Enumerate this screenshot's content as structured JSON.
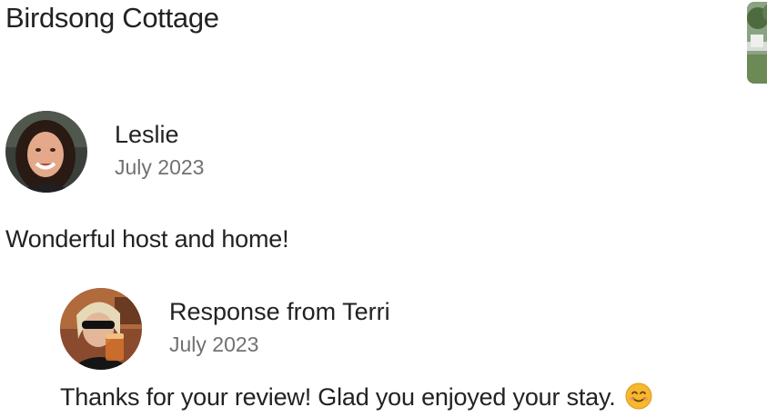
{
  "listing": {
    "title": "Birdsong Cottage",
    "thumbnail": "listing-photo"
  },
  "review": {
    "reviewer_name": "Leslie",
    "date": "July 2023",
    "text": "Wonderful host and home!",
    "avatar": "reviewer-photo"
  },
  "response": {
    "heading": "Response from Terri",
    "date": "July 2023",
    "text": "Thanks for your review! Glad you enjoyed your stay.",
    "emoji": "smiling-face-emoji",
    "avatar": "host-photo"
  },
  "colors": {
    "primary_text": "#222222",
    "secondary_text": "#717171",
    "background": "#ffffff"
  }
}
